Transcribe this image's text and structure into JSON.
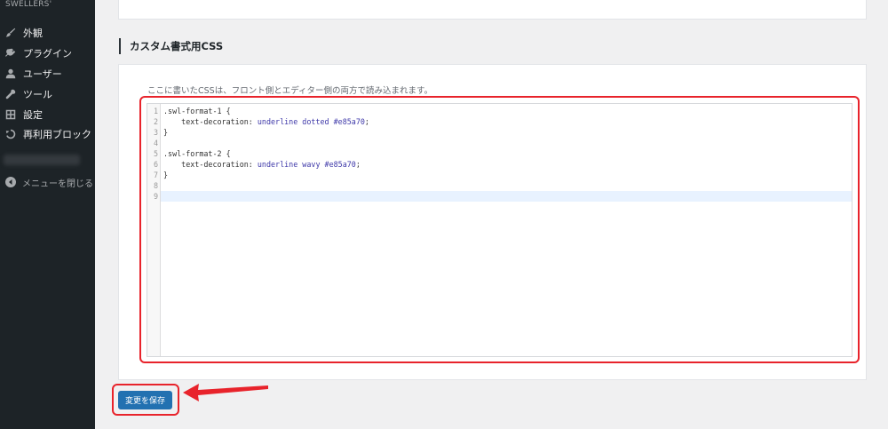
{
  "sidebar": {
    "brand": "SWELLERS'",
    "items": [
      {
        "label": "外観",
        "icon": "paintbrush-icon"
      },
      {
        "label": "プラグイン",
        "icon": "plugins-icon"
      },
      {
        "label": "ユーザー",
        "icon": "users-icon"
      },
      {
        "label": "ツール",
        "icon": "tools-icon"
      },
      {
        "label": "設定",
        "icon": "settings-icon"
      },
      {
        "label": "再利用ブロック",
        "icon": "reusable-blocks-icon"
      }
    ],
    "collapse_label": "メニューを閉じる"
  },
  "section": {
    "title": "カスタム書式用CSS",
    "description": "ここに書いたCSSは、フロント側とエディター側の両方で読み込まれます。"
  },
  "editor": {
    "lines": [
      {
        "n": "1",
        "sel": ".swl-format-1 {",
        "prop": "",
        "val": "",
        "hex": "",
        "end": ""
      },
      {
        "n": "2",
        "sel": "",
        "prop": "    text-decoration: ",
        "val": "underline dotted ",
        "hex": "#e85a70",
        "end": ";"
      },
      {
        "n": "3",
        "sel": "}",
        "prop": "",
        "val": "",
        "hex": "",
        "end": ""
      },
      {
        "n": "4",
        "sel": "",
        "prop": "",
        "val": "",
        "hex": "",
        "end": ""
      },
      {
        "n": "5",
        "sel": ".swl-format-2 {",
        "prop": "",
        "val": "",
        "hex": "",
        "end": ""
      },
      {
        "n": "6",
        "sel": "",
        "prop": "    text-decoration: ",
        "val": "underline wavy ",
        "hex": "#e85a70",
        "end": ";"
      },
      {
        "n": "7",
        "sel": "}",
        "prop": "",
        "val": "",
        "hex": "",
        "end": ""
      },
      {
        "n": "8",
        "sel": "",
        "prop": "",
        "val": "",
        "hex": "",
        "end": ""
      },
      {
        "n": "9",
        "sel": "",
        "prop": "",
        "val": "",
        "hex": "",
        "end": ""
      }
    ]
  },
  "save_button": {
    "label": "変更を保存"
  },
  "colors": {
    "highlight": "#e8232b",
    "primary": "#2271b1",
    "sidebar_bg": "#1d2327"
  }
}
